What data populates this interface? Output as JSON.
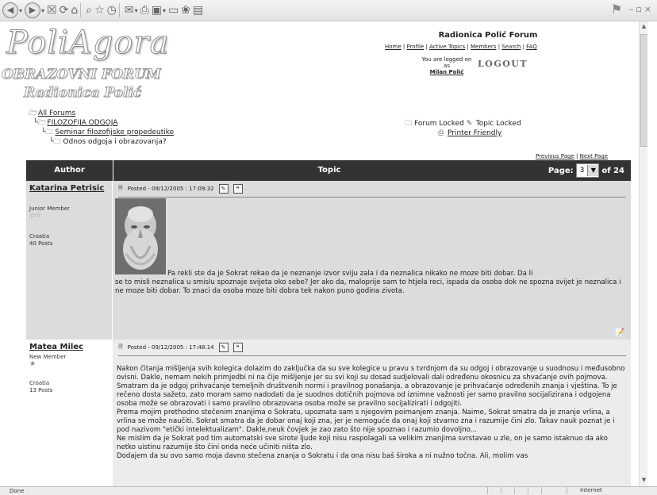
{
  "browser": {
    "toolbar_icons": [
      "back-icon",
      "forward-icon",
      "stop-icon",
      "refresh-icon",
      "home-icon",
      "search-icon",
      "favorites-icon",
      "history-icon",
      "mail-icon",
      "print-icon",
      "edit-icon",
      "discuss-icon",
      "messenger-icon",
      "research-icon"
    ],
    "status_text": "Done",
    "zone_text": "Internet"
  },
  "site": {
    "logo_main": "PoliAgora",
    "logo_line2": "OBRAZOVNI FORUM",
    "logo_line3": "Radionica Polić",
    "title": "Radionica Polić Forum",
    "nav": [
      "Home",
      "Profile",
      "Active Topics",
      "Members",
      "Search",
      "FAQ"
    ],
    "logged_prefix": "You are logged on as",
    "logged_user": "Milan Polić",
    "logout_label": "LOGOUT"
  },
  "breadcrumb": {
    "all_forums": "All Forums",
    "category": "FILOZOFIJA ODGOJA",
    "forum": "Seminar filozofijske propedeutike",
    "topic": "Odnos odgoja i obrazovanja?"
  },
  "legend": {
    "forum_locked": "Forum Locked",
    "topic_locked": "Topic Locked",
    "printer_friendly": "Printer Friendly"
  },
  "pager": {
    "previous": "Previous Page",
    "next": "Next Page",
    "sep": "|"
  },
  "table": {
    "col_author": "Author",
    "col_topic": "Topic",
    "page_label": "Page:",
    "page_value": "3",
    "page_total": "of 24"
  },
  "posts": [
    {
      "author": "Katarina Petrisic",
      "rank": "Junior Member",
      "stars": "☆☆",
      "country": "Croatia",
      "posts": "40 Posts",
      "posted": "Posted - 09/12/2005 :  17:09:32",
      "body_first": "Pa rekli ste da je Sokrat rekao da je neznanje izvor sviju zala i da neznalica nikako ne moze biti dobar. Da li",
      "body_rest": "se to misli neznalica u smislu spoznaje svijeta oko sebe? Jer ako da, maloprije sam to htjela reci, ispada da osoba dok ne spozna svijet je neznalica i ne moze biti dobar. To znaci da osoba moze biti dobra tek nakon puno godina zivota."
    },
    {
      "author": "Matea Milec",
      "rank": "New Member",
      "stars": "★",
      "country": "Croatia",
      "posts": "13 Posts",
      "posted": "Posted - 09/12/2005 :  17:48:14",
      "body": "Nakon čitanja mišljenja svih kolegica dolazim do zaključka da su sve kolegice u pravu s tvrdnjom da su odgoj i obrazovanje u suodnosu i međusobno ovisni. Dakle, nemam nekih primjedbi ni na čije mišljenje jer su svi koji su dosad sudjelovali dali određenu okosnicu za shvaćanje ovih pojmova.\nSmatram da je odgoj prihvaćanje temeljnih društvenih normi i pravilnog ponašanja, a obrazovanje je prihvaćanje određenih znanja i vještina. To je rečeno dosta sažeto, zato moram samo nadodati da je suodnos dotičnih pojmova od iznimne važnosti jer samo pravilno socijalizirana i odgojena osoba može se obrazovati i samo pravilno obrazovana osoba može se pravilno socijalizirati i odgojiti.\nPrema mojim prethodno stečenim znanjima o Sokratu, upoznata sam s njegovim poimanjem znanja. Naime, Sokrat smatra da je znanje vrlina, a vrlina se može naučiti. Sokrat smatra da je dobar onaj koji zna, jer je nemoguće da onaj koji stvarno zna i razumije čini zlo. Takav nauk poznat je i pod nazivom \"etički intelektualizam\". Dakle,neuk čovjek je zao zato što nije spoznao i razumio dovoljno...\nNe mislim da je Sokrat pod tim automatski sve sirote ljude koji nisu raspolagali sa velikim znanjima svrstavao u zle, on je samo istaknuo da ako netko uistinu razumije što čini onda neće učiniti ništa zlo.\nDodajem da su ovo samo moja davno stečena znanja o Sokratu i da ona nisu baš široka a ni nužno točna. Ali, molim vas"
    }
  ]
}
